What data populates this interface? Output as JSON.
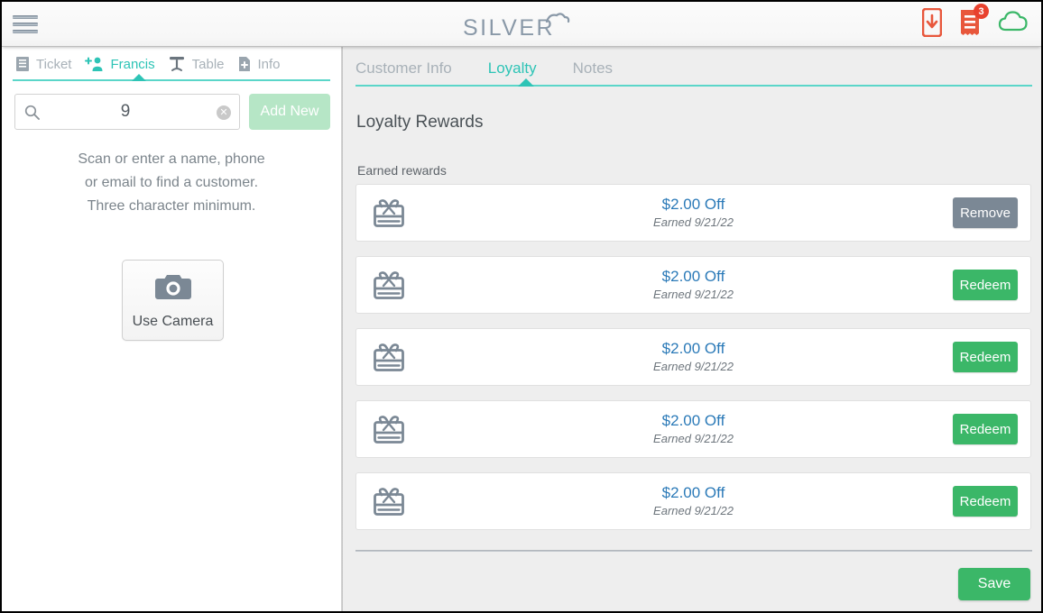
{
  "header": {
    "menu_icon": "hamburger-menu-icon",
    "logo_text": "SILVER",
    "logo_mark": "cloud-icon",
    "icons": [
      {
        "name": "cash-drawer-icon",
        "badge": null
      },
      {
        "name": "receipt-icon",
        "badge": "3"
      },
      {
        "name": "cloud-status-icon",
        "badge": null
      }
    ]
  },
  "left_panel": {
    "tabs": [
      {
        "label": "Ticket",
        "icon": "ticket-icon",
        "active": false
      },
      {
        "label": "Francis",
        "icon": "add-person-icon",
        "active": true
      },
      {
        "label": "Table",
        "icon": "table-icon",
        "active": false
      },
      {
        "label": "Info",
        "icon": "info-document-icon",
        "active": false
      }
    ],
    "search": {
      "value": "9",
      "placeholder": "",
      "icon": "search-icon",
      "clear_icon": "clear-x-icon"
    },
    "add_new_label": "Add New",
    "hint_lines": [
      "Scan or enter a name, phone",
      "or email to find a customer.",
      "Three character minimum."
    ],
    "use_camera": {
      "label": "Use Camera",
      "icon": "camera-icon"
    }
  },
  "right_panel": {
    "tabs": [
      {
        "label": "Customer Info",
        "active": false
      },
      {
        "label": "Loyalty",
        "active": true
      },
      {
        "label": "Notes",
        "active": false
      }
    ],
    "section_title": "Loyalty Rewards",
    "list_label": "Earned rewards",
    "rewards": [
      {
        "icon": "gift-card-icon",
        "amount": "$2.00 Off",
        "earned": "Earned 9/21/22",
        "action": "Remove",
        "action_type": "remove"
      },
      {
        "icon": "gift-card-icon",
        "amount": "$2.00 Off",
        "earned": "Earned 9/21/22",
        "action": "Redeem",
        "action_type": "redeem"
      },
      {
        "icon": "gift-card-icon",
        "amount": "$2.00 Off",
        "earned": "Earned 9/21/22",
        "action": "Redeem",
        "action_type": "redeem"
      },
      {
        "icon": "gift-card-icon",
        "amount": "$2.00 Off",
        "earned": "Earned 9/21/22",
        "action": "Redeem",
        "action_type": "redeem"
      },
      {
        "icon": "gift-card-icon",
        "amount": "$2.00 Off",
        "earned": "Earned 9/21/22",
        "action": "Redeem",
        "action_type": "redeem"
      }
    ],
    "save_label": "Save"
  },
  "colors": {
    "accent_teal": "#2ec4b6",
    "green": "#3bb768",
    "green_disabled": "#b6e6c6",
    "slate": "#7b8895",
    "blue_text": "#2b7ab8",
    "orange": "#e8573c",
    "badge_red": "#e8412e",
    "panel_bg": "#eeeeee"
  }
}
